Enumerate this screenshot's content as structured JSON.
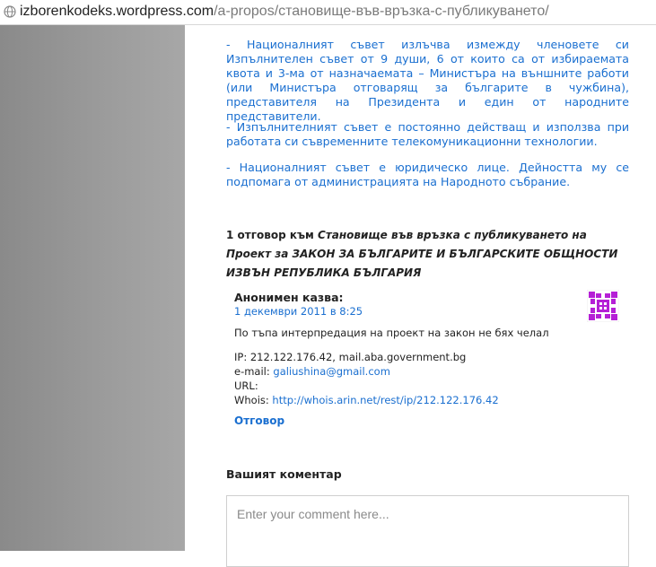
{
  "browser": {
    "url_host": "izborenkodeks.wordpress.com",
    "url_path": "/a-propos/становище-във-връзка-с-публикуването/"
  },
  "article": {
    "paragraphs": [
      "- Националният съвет излъчва измежду членовете си Изпълнителен съвет от 9 души, 6 от които са от избираемата квота и 3-ма от назначаемата – Министъра на външните работи (или Министъра отговарящ за българите в чужбина), представителя на Президента и един от народните представители.",
      "- Изпълнителният съвет е постоянно действащ и използва при работата си съвременните телекомуникационни технологии.",
      "- Националният съвет е юридическо лице. Дейността му се подпомага от администрацията на Народното събрание."
    ]
  },
  "comments": {
    "count": "1",
    "title_mid": " отговор към ",
    "title_italic": "Становище във връзка с публикуването на Проект за ЗАКОН ЗА БЪЛГАРИТЕ И БЪЛГАРСКИТЕ ОБЩНОСТИ ИЗВЪН РЕПУБЛИКА БЪЛГАРИЯ",
    "items": [
      {
        "author": "Анонимен казва:",
        "date": "1 декември 2011 в 8:25",
        "text": "По тъпа интерпредация на проект на закон не бях челал",
        "ip_label": "IP: ",
        "ip": "212.122.176.42, mail.aba.government.bg",
        "email_label": "e-mail: ",
        "email": "galiushina@gmail.com",
        "url_label": "URL:",
        "whois_label": "Whois: ",
        "whois": "http://whois.arin.net/rest/ip/212.122.176.42",
        "reply": "Отговор"
      }
    ]
  },
  "form": {
    "heading": "Вашият коментар",
    "placeholder": "Enter your comment here..."
  },
  "colors": {
    "link": "#1a6fd0",
    "avatar": "#b51fd6"
  }
}
